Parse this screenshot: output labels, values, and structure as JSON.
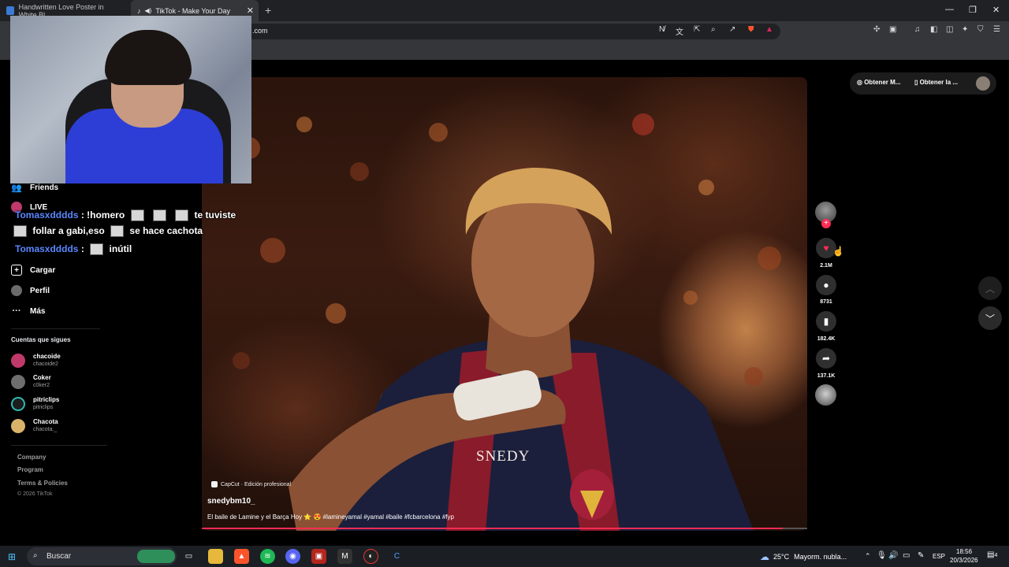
{
  "browser": {
    "tabs": [
      {
        "title": "Handwritten Love Poster in White Bl..."
      },
      {
        "title": "TikTok - Make Your Day"
      }
    ],
    "url": ".com"
  },
  "tiktok": {
    "sidebar": {
      "friends": "Friends",
      "live": "LIVE",
      "upload": "Cargar",
      "profile": "Perfil",
      "more": "Más"
    },
    "following_title": "Cuentas que sigues",
    "following": [
      {
        "name": "chacoide",
        "handle": "chacoide2",
        "color": "#c0396b"
      },
      {
        "name": "Coker",
        "handle": "c0ker2",
        "color": "#6e6e6e"
      },
      {
        "name": "pitriclips",
        "handle": "pitriclips",
        "color": "#2fb7b2"
      },
      {
        "name": "Chacota",
        "handle": "chacota._",
        "color": "#d9b36a"
      }
    ],
    "footer": {
      "company": "Company",
      "program": "Program",
      "terms": "Terms & Policies",
      "copyright": "© 2026 TikTok"
    },
    "top_actions": {
      "get_coins": "Obtener M...",
      "get_app": "Obtener la ..."
    },
    "video": {
      "overlay_text": "SNEDY",
      "capcut_label": "CapCut · Edición profesional",
      "author": "snedybm10_",
      "description": "El baile de Lamine y el Barça Hoy ⭐ 😍 #lamineyamal #yamal #baile #fcbarcelona #fyp",
      "progress": 0.96
    },
    "actions": {
      "likes": "2.1M",
      "comments": "8731",
      "saves": "182.4K",
      "shares": "137.1K"
    }
  },
  "chat": {
    "line1": {
      "user": "Tomasxdddds",
      "text_a": ": !homero",
      "text_b": "te tuviste"
    },
    "line2": {
      "text_a": "follar a gabi,eso",
      "text_b": "se hace cachota"
    },
    "line3": {
      "user": "Tomasxdddds",
      "text_a": ":",
      "text_b": "inútil"
    }
  },
  "taskbar": {
    "search": "Buscar",
    "weather_temp": "25°C",
    "weather_text": "Mayorm. nubla...",
    "lang": "ESP",
    "time": "18:56",
    "date": "20/3/2026",
    "notifications": "4"
  },
  "colors": {
    "accent": "#fe2c55",
    "chat_user": "#5a86ff",
    "webcam_shirt": "#2d3ed6"
  }
}
